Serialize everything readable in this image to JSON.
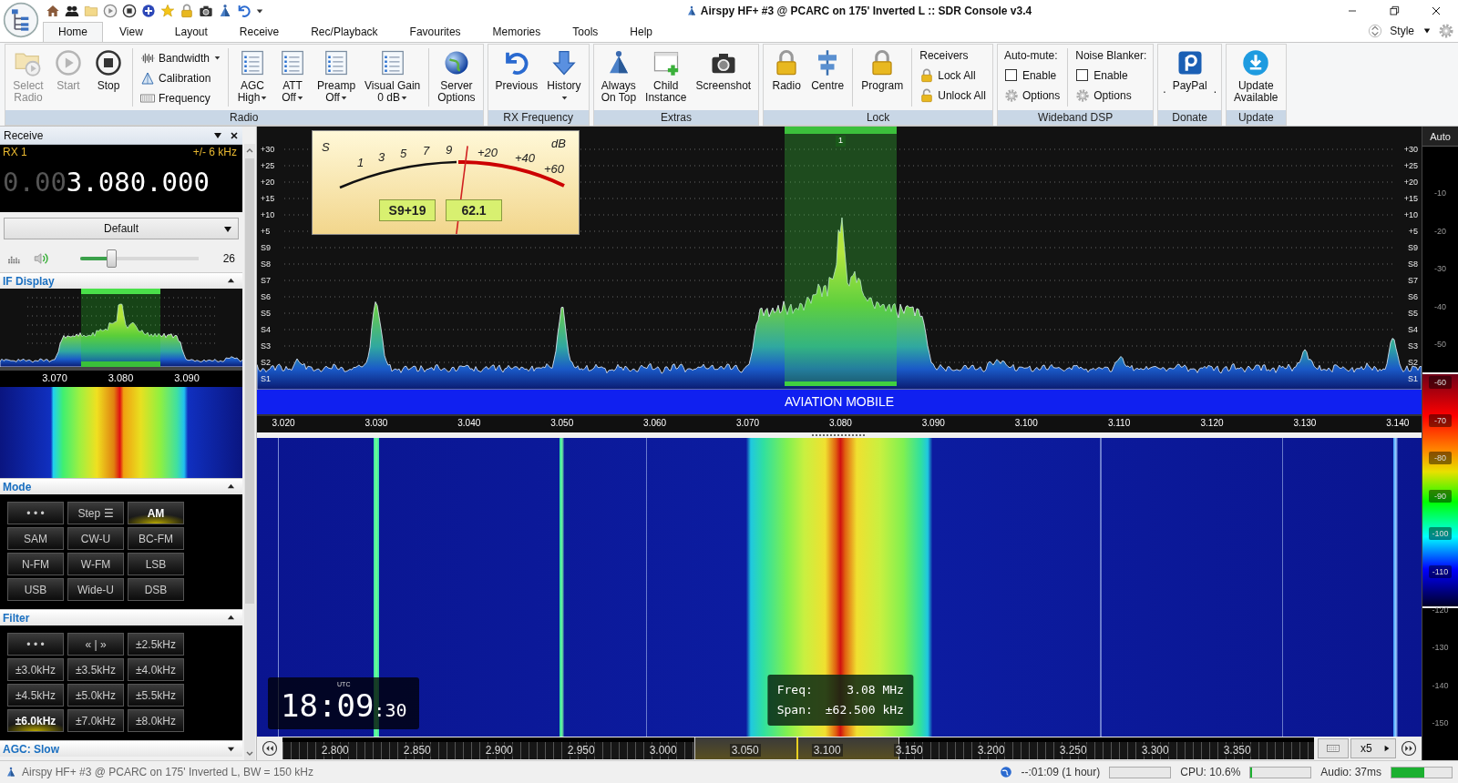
{
  "window": {
    "title": "Airspy HF+ #3 @ PCARC on 175' Inverted L :: SDR Console v3.4"
  },
  "tabs": [
    {
      "label": "Home",
      "selected": true
    },
    {
      "label": "View",
      "selected": false
    },
    {
      "label": "Layout",
      "selected": false
    },
    {
      "label": "Receive",
      "selected": false
    },
    {
      "label": "Rec/Playback",
      "selected": false
    },
    {
      "label": "Favourites",
      "selected": false
    },
    {
      "label": "Memories",
      "selected": false
    },
    {
      "label": "Tools",
      "selected": false
    },
    {
      "label": "Help",
      "selected": false
    }
  ],
  "style_menu": {
    "label": "Style"
  },
  "ribbon": [
    {
      "label": "Radio",
      "columns": [
        {
          "divider": false,
          "items": [
            {
              "kind": "large",
              "lines": [
                "Select",
                "Radio"
              ],
              "dropdown": false,
              "disabled": true
            }
          ]
        },
        {
          "divider": false,
          "items": [
            {
              "kind": "large",
              "lines": [
                "Start"
              ],
              "dropdown": false,
              "disabled": true
            }
          ]
        },
        {
          "divider": false,
          "items": [
            {
              "kind": "large",
              "lines": [
                "Stop"
              ],
              "dropdown": false,
              "disabled": false
            }
          ]
        },
        {
          "divider": true,
          "items": [
            {
              "kind": "small",
              "label": "Bandwidth",
              "dropdown": true,
              "disabled": false
            },
            {
              "kind": "small",
              "label": "Calibration",
              "dropdown": false,
              "disabled": false
            },
            {
              "kind": "small",
              "label": "Frequency",
              "dropdown": false,
              "disabled": false
            }
          ]
        },
        {
          "divider": true,
          "items": [
            {
              "kind": "large",
              "lines": [
                "AGC",
                "High"
              ],
              "dropdown": true,
              "disabled": false
            }
          ]
        },
        {
          "divider": false,
          "items": [
            {
              "kind": "large",
              "lines": [
                "ATT",
                "Off"
              ],
              "dropdown": true,
              "disabled": false
            }
          ]
        },
        {
          "divider": false,
          "items": [
            {
              "kind": "large",
              "lines": [
                "Preamp",
                "Off"
              ],
              "dropdown": true,
              "disabled": false
            }
          ]
        },
        {
          "divider": false,
          "items": [
            {
              "kind": "large",
              "lines": [
                "Visual Gain",
                "0 dB"
              ],
              "dropdown": true,
              "disabled": false
            }
          ]
        },
        {
          "divider": true,
          "items": [
            {
              "kind": "large",
              "lines": [
                "Server",
                "Options"
              ],
              "dropdown": false,
              "disabled": false
            }
          ]
        }
      ]
    },
    {
      "label": "RX Frequency",
      "columns": [
        {
          "divider": false,
          "items": [
            {
              "kind": "large",
              "lines": [
                "Previous"
              ],
              "dropdown": false,
              "disabled": false
            }
          ]
        },
        {
          "divider": false,
          "items": [
            {
              "kind": "large",
              "lines": [
                "History"
              ],
              "dropdown": true,
              "disabled": false
            }
          ]
        }
      ]
    },
    {
      "label": "Extras",
      "columns": [
        {
          "divider": false,
          "items": [
            {
              "kind": "large",
              "lines": [
                "Always",
                "On Top"
              ],
              "dropdown": false,
              "disabled": false
            }
          ]
        },
        {
          "divider": false,
          "items": [
            {
              "kind": "large",
              "lines": [
                "Child",
                "Instance"
              ],
              "dropdown": false,
              "disabled": false
            }
          ]
        },
        {
          "divider": false,
          "items": [
            {
              "kind": "large",
              "lines": [
                "Screenshot"
              ],
              "dropdown": false,
              "disabled": false
            }
          ]
        }
      ]
    },
    {
      "label": "Lock",
      "columns": [
        {
          "divider": false,
          "items": [
            {
              "kind": "large",
              "lines": [
                "Radio"
              ],
              "dropdown": false,
              "disabled": false
            }
          ]
        },
        {
          "divider": false,
          "items": [
            {
              "kind": "large",
              "lines": [
                "Centre"
              ],
              "dropdown": false,
              "disabled": false
            }
          ]
        },
        {
          "divider": true,
          "items": [
            {
              "kind": "large",
              "lines": [
                "Program"
              ],
              "dropdown": false,
              "disabled": false
            }
          ]
        },
        {
          "divider": true,
          "items": [
            {
              "kind": "label",
              "label": "Receivers"
            },
            {
              "kind": "small",
              "label": "Lock All",
              "dropdown": false,
              "disabled": false
            },
            {
              "kind": "small",
              "label": "Unlock All",
              "dropdown": false,
              "disabled": false
            }
          ]
        }
      ]
    },
    {
      "label": "Wideband DSP",
      "columns": [
        {
          "divider": false,
          "items": [
            {
              "kind": "label",
              "label": "Auto-mute:"
            },
            {
              "kind": "checkbox",
              "label": "Enable",
              "checked": false
            },
            {
              "kind": "small",
              "label": "Options",
              "dropdown": false,
              "disabled": false
            }
          ]
        },
        {
          "divider": true,
          "items": [
            {
              "kind": "label",
              "label": "Noise Blanker:"
            },
            {
              "kind": "checkbox",
              "label": "Enable",
              "checked": false
            },
            {
              "kind": "small",
              "label": "Options",
              "dropdown": false,
              "disabled": false
            }
          ]
        }
      ]
    },
    {
      "label": "Donate",
      "columns": [
        {
          "divider": false,
          "items": [
            {
              "kind": "mark",
              "label": "."
            }
          ]
        },
        {
          "divider": false,
          "items": [
            {
              "kind": "large",
              "lines": [
                "PayPal"
              ],
              "dropdown": false,
              "disabled": false
            }
          ]
        },
        {
          "divider": false,
          "items": [
            {
              "kind": "mark",
              "label": "."
            }
          ]
        }
      ]
    },
    {
      "label": "Update",
      "columns": [
        {
          "divider": false,
          "items": [
            {
              "kind": "large",
              "lines": [
                "Update",
                "Available"
              ],
              "dropdown": false,
              "disabled": false
            }
          ]
        }
      ]
    }
  ],
  "receive_panel": {
    "title": "Receive",
    "rx_label": "RX 1",
    "bandwidth": "+/- 6 kHz",
    "frequency_prefix": "0.00",
    "frequency": "3.080.000",
    "preset": "Default",
    "volume": {
      "level": 0.26,
      "reading": "26"
    },
    "if_display": {
      "title": "IF Display",
      "expanded": true,
      "ticks": [
        "3.070",
        "3.080",
        "3.090"
      ]
    },
    "mode": {
      "title": "Mode",
      "expanded": true,
      "buttons": [
        {
          "label": "• • •",
          "selected": false
        },
        {
          "label": "Step ☰",
          "selected": false
        },
        {
          "label": "AM",
          "selected": true
        },
        {
          "label": "SAM",
          "selected": false
        },
        {
          "label": "CW-U",
          "selected": false
        },
        {
          "label": "BC-FM",
          "selected": false
        },
        {
          "label": "N-FM",
          "selected": false
        },
        {
          "label": "W-FM",
          "selected": false
        },
        {
          "label": "LSB",
          "selected": false
        },
        {
          "label": "USB",
          "selected": false
        },
        {
          "label": "Wide-U",
          "selected": false
        },
        {
          "label": "DSB",
          "selected": false
        }
      ]
    },
    "filter": {
      "title": "Filter",
      "expanded": true,
      "buttons": [
        {
          "label": "• • •",
          "selected": false
        },
        {
          "label": "« | »",
          "selected": false
        },
        {
          "label": "±2.5kHz",
          "selected": false
        },
        {
          "label": "±3.0kHz",
          "selected": false
        },
        {
          "label": "±3.5kHz",
          "selected": false
        },
        {
          "label": "±4.0kHz",
          "selected": false
        },
        {
          "label": "±4.5kHz",
          "selected": false
        },
        {
          "label": "±5.0kHz",
          "selected": false
        },
        {
          "label": "±5.5kHz",
          "selected": false
        },
        {
          "label": "±6.0kHz",
          "selected": true
        },
        {
          "label": "±7.0kHz",
          "selected": false
        },
        {
          "label": "±8.0kHz",
          "selected": false
        }
      ]
    },
    "agc": {
      "title": "AGC: Slow",
      "expanded": false
    }
  },
  "spectrum": {
    "level_labels": [
      "+30",
      "+25",
      "+20",
      "+15",
      "+10",
      "+5",
      "S9",
      "S8",
      "S7",
      "S6",
      "S5",
      "S4",
      "S3",
      "S2",
      "S1"
    ],
    "level_labels_right": [
      "+30",
      "+25",
      "+20",
      "+15",
      "+10",
      "+5",
      "S9",
      "S8",
      "S7",
      "S6",
      "S5",
      "S4",
      "S3",
      "S2",
      "S1"
    ],
    "passband_marker": "1",
    "band_label": "AVIATION MOBILE",
    "frequency_ticks": [
      "3.020",
      "3.030",
      "3.040",
      "3.050",
      "3.060",
      "3.070",
      "3.080",
      "3.090",
      "3.100",
      "3.110",
      "3.120",
      "3.130",
      "3.140"
    ]
  },
  "s_meter": {
    "scale": [
      "S",
      "1",
      "3",
      "5",
      "7",
      "9",
      "+20",
      "+40",
      "+60",
      "dB"
    ],
    "level": 0.56,
    "signal": "S9+19",
    "power": "62.1"
  },
  "waterfall": {
    "clock": {
      "zone": "UTC",
      "time": "18:09",
      "seconds": ":30"
    },
    "info": {
      "freq_label": "Freq:",
      "freq": "3.08 MHz",
      "span_label": "Span:",
      "span": "±62.500 kHz"
    },
    "scale_ticks": [
      "2.800",
      "2.850",
      "2.900",
      "2.950",
      "3.000",
      "3.050",
      "3.100",
      "3.150",
      "3.200",
      "3.250",
      "3.300",
      "3.350"
    ],
    "zoom": "x5"
  },
  "color_scale": {
    "mode": "Auto",
    "labels": [
      "-10",
      "-20",
      "-30",
      "-40",
      "-50",
      "-60",
      "-70",
      "-80",
      "-90",
      "-100",
      "-110",
      "-120",
      "-130",
      "-140",
      "-150"
    ]
  },
  "status_bar": {
    "text": "Airspy HF+ #3 @ PCARC on 175' Inverted L, BW = 150 kHz",
    "time": {
      "label": "--:01:09 (1 hour)",
      "level": 0
    },
    "cpu": {
      "label": "CPU: 10.6%",
      "level": 0.03
    },
    "audio": {
      "label": "Audio: 37ms",
      "level": 0.55
    }
  }
}
